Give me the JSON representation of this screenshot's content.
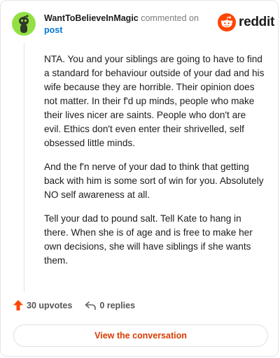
{
  "comment": {
    "author": "WantToBelieveInMagic",
    "action_text": "commented on",
    "target_link": "post",
    "paragraphs": [
      "NTA. You and your siblings are going to have to find a standard for behaviour outside of your dad and his wife because they are horrible. Their opinion does not matter. In their f'd up minds, people who make their lives nicer are saints. People who don't are evil. Ethics don't even enter their shrivelled, self obsessed little minds.",
      "And the f'n nerve of your dad to think that getting back with him is some sort of win for you. Absolutely NO self awareness at all.",
      "Tell your dad to pound salt. Tell Kate to hang in there. When she is of age and is free to make her own decisions, she will have siblings if she wants them."
    ],
    "upvotes_label": "30 upvotes",
    "replies_label": "0 replies"
  },
  "brand": {
    "logo_text": "reddit",
    "accent_color": "#ff4500"
  },
  "footer": {
    "view_button_label": "View the conversation"
  },
  "icons": [
    "avatar-snoo-icon",
    "reddit-logo-icon",
    "upvote-arrow-icon",
    "reply-arrow-icon"
  ]
}
